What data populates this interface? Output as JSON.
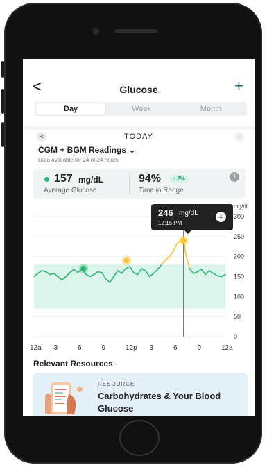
{
  "header": {
    "title": "Glucose",
    "back_icon": "chevron-left-icon",
    "add_icon": "plus-icon",
    "back_glyph": "<",
    "add_glyph": "+"
  },
  "tabs": [
    {
      "label": "Day",
      "active": true
    },
    {
      "label": "Week",
      "active": false
    },
    {
      "label": "Month",
      "active": false
    }
  ],
  "date_nav": {
    "label": "TODAY",
    "prev_glyph": "<",
    "next_glyph": ">"
  },
  "readings": {
    "title": "CGM + BGM Readings ⌄",
    "availability": "Data available for 24 of 24 hours"
  },
  "stats": {
    "average": {
      "value": "157",
      "unit": "mg/dL",
      "label": "Average Glucose"
    },
    "time_in_range": {
      "value": "94%",
      "change": "↑ 2%",
      "label": "Time in Range"
    },
    "info_icon": "info-icon",
    "info_glyph": "i"
  },
  "tooltip": {
    "value": "246",
    "unit": "mg/dL",
    "time": "12:15 PM",
    "add_glyph": "+"
  },
  "colors": {
    "accent": "#1c6b74",
    "in_range": "#2bb673",
    "high": "#f4c430",
    "range_band": "#dcf5ec"
  },
  "chart_data": {
    "type": "line",
    "ylabel": "mg/dL",
    "y_ticks": [
      0,
      50,
      100,
      150,
      200,
      250,
      300
    ],
    "ylim": [
      0,
      300
    ],
    "target_range": [
      70,
      180
    ],
    "x_ticks": [
      "12a",
      "3",
      "6",
      "9",
      "12p",
      "3",
      "6",
      "9",
      "12a"
    ],
    "x": [
      0,
      0.5,
      1,
      1.5,
      2,
      2.5,
      3,
      3.5,
      4,
      4.5,
      5,
      5.5,
      6,
      6.5,
      7,
      7.5,
      8,
      8.5,
      9,
      9.5,
      10,
      10.5,
      11,
      11.5,
      12,
      12.5,
      13,
      13.5,
      14,
      14.5,
      15,
      15.5,
      16,
      16.5,
      17,
      17.5,
      18,
      18.5,
      18.75,
      19,
      19.5,
      20,
      20.5,
      21,
      21.5,
      22,
      22.5,
      23,
      23.5,
      24
    ],
    "values": [
      150,
      158,
      165,
      162,
      155,
      158,
      150,
      142,
      150,
      160,
      168,
      160,
      168,
      156,
      150,
      155,
      162,
      160,
      145,
      135,
      150,
      165,
      158,
      170,
      175,
      160,
      155,
      170,
      164,
      150,
      158,
      168,
      180,
      192,
      200,
      215,
      235,
      240,
      246,
      210,
      170,
      158,
      162,
      168,
      155,
      165,
      158,
      152,
      150,
      155
    ],
    "markers": [
      {
        "x": 6.2,
        "y": 170,
        "kind": "in_range"
      },
      {
        "x": 11.6,
        "y": 190,
        "kind": "high"
      },
      {
        "x": 18.75,
        "y": 240,
        "kind": "high"
      }
    ],
    "selected_x": 18.75
  },
  "resources": {
    "title": "Relevant Resources",
    "card": {
      "kicker": "RESOURCE",
      "title": "Carbohydrates & Your Blood Glucose"
    }
  }
}
